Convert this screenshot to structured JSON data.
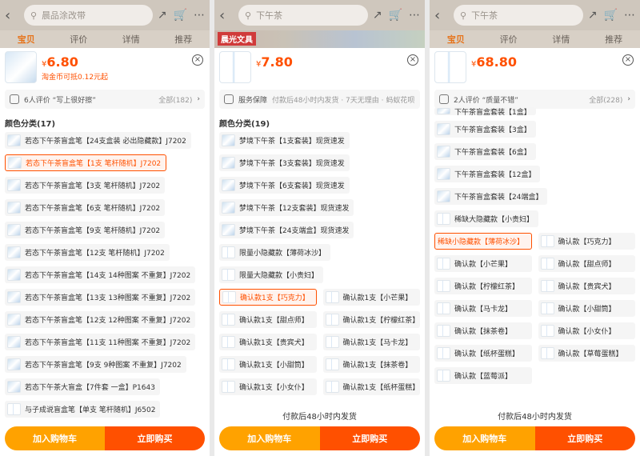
{
  "panel1": {
    "search_placeholder": "晨品涂改带",
    "tabs": [
      "宝贝",
      "评价",
      "详情",
      "推荐"
    ],
    "price_symbol": "¥",
    "price": "6.80",
    "coin_note": "淘金币可抵0.12元起",
    "review_bar": "6人评价 “写上很好擦”",
    "review_all": "全部(182)",
    "section_title": "颜色分类(17)",
    "options": [
      "若态下午茶盲盒笔【24支盒装 必出隐藏款】J7202",
      "若态下午茶盲盒笔【1支 笔杆随机】J7202",
      "若态下午茶盲盒笔【3支 笔杆随机】J7202",
      "若态下午茶盲盒笔【6支 笔杆随机】J7202",
      "若态下午茶盲盒笔【9支 笔杆随机】J7202",
      "若态下午茶盲盒笔【12支 笔杆随机】J7202",
      "若态下午茶盲盒笔【14支 14种图案 不重复】J7202",
      "若态下午茶盲盒笔【13支 13种图案 不重复】J7202",
      "若态下午茶盲盒笔【12支 12种图案 不重复】J7202",
      "若态下午茶盲盒笔【11支 11种图案 不重复】J7202",
      "若态下午茶盲盒笔【9支 9种图案 不重复】J7202",
      "若态下午茶大盲盒【7件套 一盒】P1643",
      "与子成说盲盒笔【单支 笔杆随机】J6502"
    ],
    "add_cart": "加入购物车",
    "buy_now": "立即购买"
  },
  "panel2": {
    "search_placeholder": "下午茶",
    "tabs": [],
    "banner_text": "晨光文具",
    "price_symbol": "¥",
    "price": "7.80",
    "service_label": "服务保障",
    "service_text": "付款后48小时内发货 · 7天无理由 · 蚂蚁花呗",
    "section_title": "颜色分类(19)",
    "options_single": [
      "梦境下午茶【1支套装】现货速发",
      "梦境下午茶【3支套装】现货速发",
      "梦境下午茶【6支套装】现货速发",
      "梦境下午茶【12支套装】现货速发",
      "梦境下午茶【24支端盒】现货速发",
      "限量小隐藏款【薄荷冰沙】",
      "限量大隐藏款【小贵妇】"
    ],
    "options_grid": [
      "确认款1支【巧克力】",
      "确认款1支【小芒果】",
      "确认款1支【甜点师】",
      "确认款1支【柠檬红茶】",
      "确认款1支【贵宾犬】",
      "确认款1支【马卡龙】",
      "确认款1支【小甜筒】",
      "确认款1支【抹茶卷】",
      "确认款1支【小女仆】",
      "确认款1支【纸杯蛋糕】"
    ],
    "ship_note": "付款后48小时内发货",
    "add_cart": "加入购物车",
    "buy_now": "立即购买"
  },
  "panel3": {
    "search_placeholder": "下午茶",
    "tabs": [
      "宝贝",
      "评价",
      "详情",
      "推荐"
    ],
    "price_symbol": "¥",
    "price": "68.80",
    "review_bar": "2人评价 “质量不错”",
    "review_all": "全部(228)",
    "options_single": [
      "下午茶盲盒套装【1盒】",
      "下午茶盲盒套装【3盒】",
      "下午茶盲盒套装【6盒】",
      "下午茶盲盒套装【12盒】",
      "下午茶盲盒套装【24端盒】",
      "稀缺大隐藏款【小贵妇】"
    ],
    "options_grid": [
      "稀缺小隐藏款【薄荷冰沙】",
      "确认款【巧克力】",
      "确认款【小芒果】",
      "确认款【甜点师】",
      "确认款【柠檬红茶】",
      "确认款【贵宾犬】",
      "确认款【马卡龙】",
      "确认款【小甜筒】",
      "确认款【抹茶卷】",
      "确认款【小女仆】",
      "确认款【纸杯蛋糕】",
      "确认款【草莓蛋糕】",
      "确认款【蓝莓派】"
    ],
    "ship_note": "付款后48小时内发货",
    "add_cart": "加入购物车",
    "buy_now": "立即购买"
  },
  "icons": [
    "back-arrow-icon",
    "search-icon",
    "share-icon",
    "cart-icon",
    "more-icon",
    "close-icon",
    "chevron-right-icon",
    "shield-icon",
    "comment-icon"
  ],
  "colors": {
    "accent": "#ff5000",
    "cart_button": "#ffa200"
  }
}
